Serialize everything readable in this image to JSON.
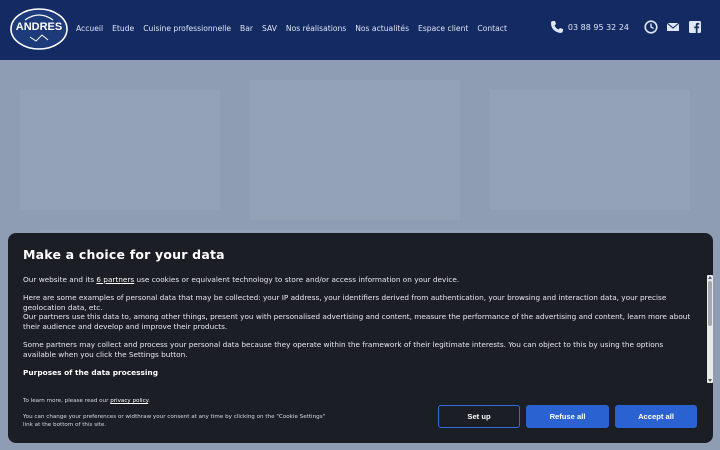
{
  "header": {
    "logo_text": "ANDRES",
    "nav": [
      "Accueil",
      "Etude",
      "Cuisine professionnelle",
      "Bar",
      "SAV",
      "Nos réalisations",
      "Nos actualités",
      "Espace client",
      "Contact"
    ],
    "phone": "03 88 95 32 24",
    "icons": [
      "phone-icon",
      "clock-icon",
      "mail-icon",
      "facebook-icon"
    ],
    "colors": {
      "background": "#132a63",
      "text": "#dfe6f5"
    }
  },
  "consent": {
    "title": "Make a choice for your data",
    "intro_before": "Our website and its ",
    "partners_link": "6 partners",
    "intro_after": " use cookies or equivalent technology to store and/or access information on your device.",
    "paragraph2": "Here are some examples of personal data that may be collected: your IP address, your identifiers derived from authentication, your browsing and interaction data, your precise geolocation data, etc.",
    "paragraph3": "Our partners use this data to, among other things, present you with personalised advertising and content, measure the performance of the advertising and content, learn more about their audience and develop and improve their products.",
    "paragraph4": "Some partners may collect and process your personal data because they operate within the framework of their legitimate interests. You can object to this by using the options available when you click the Settings button.",
    "purposes_title": "Purposes of the data processing",
    "learn_more_prefix": "To learn more, please read our ",
    "privacy_link": "privacy policy",
    "learn_more_suffix": ".",
    "change_note": "You can change your preferences or widthraw your consent at any time by clicking on the \"Cookie Settings\" link at the bottom of this site.",
    "buttons": {
      "setup": "Set up",
      "refuse": "Refuse all",
      "accept": "Accept all"
    },
    "colors": {
      "modal_bg": "#1b1e24",
      "button": "#2a63d1"
    }
  }
}
